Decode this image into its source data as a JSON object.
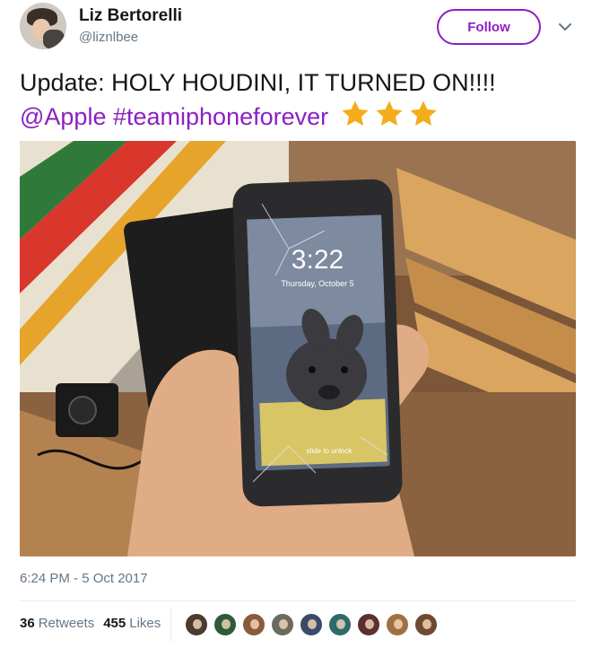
{
  "user": {
    "name": "Liz Bertorelli",
    "handle": "@liznlbee"
  },
  "follow_label": "Follow",
  "tweet": {
    "line1": "Update: HOLY HOUDINI, IT TURNED ON!!!!",
    "mention": "@Apple",
    "hashtag": "#teamiphoneforever",
    "star_count": 3,
    "star_color": "#f5ac1a"
  },
  "photo": {
    "lock_time": "3:22",
    "lock_date": "Thursday, October 5",
    "slide_text": "slide to unlock"
  },
  "timestamp": "6:24 PM - 5 Oct 2017",
  "stats": {
    "retweets_count": "36",
    "retweets_label": "Retweets",
    "likes_count": "455",
    "likes_label": "Likes"
  },
  "likers": [
    {
      "color": "#4a3a30"
    },
    {
      "color": "#2f5b3a"
    },
    {
      "color": "#8a5a3c"
    },
    {
      "color": "#6a6a60"
    },
    {
      "color": "#3a4a6a"
    },
    {
      "color": "#2d6a6a"
    },
    {
      "color": "#5a3030"
    },
    {
      "color": "#a07040"
    },
    {
      "color": "#704a30"
    }
  ],
  "colors": {
    "accent": "#8b1fc4",
    "muted": "#657786"
  }
}
